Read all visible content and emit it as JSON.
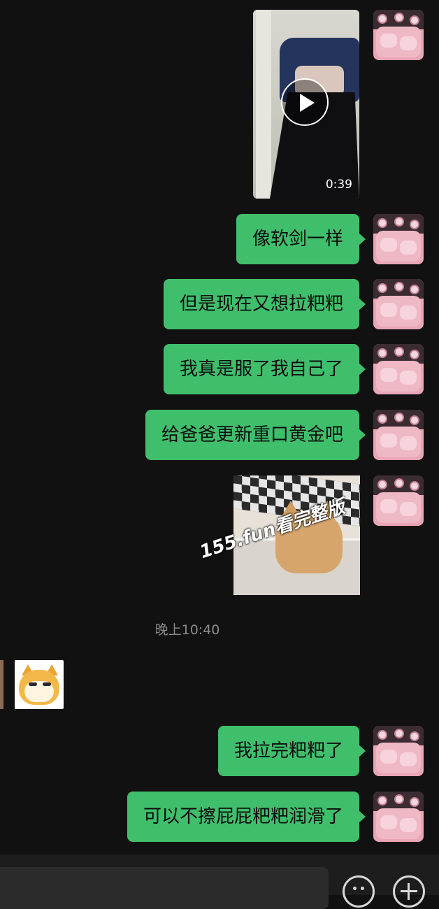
{
  "chat": {
    "video_message": {
      "duration": "0:39",
      "play_icon": "play-icon"
    },
    "messages": [
      "像软剑一样",
      "但是现在又想拉粑粑",
      "我真是服了我自己了",
      "给爸爸更新重口黄金吧"
    ],
    "sticker_message": {
      "watermark": "155.fun看完整版"
    },
    "timestamp": "晚上10:40",
    "received_sticker": "doge-sticker",
    "messages_after": [
      "我拉完粑粑了",
      "可以不擦屁屁粑粑润滑了"
    ]
  },
  "input_bar": {
    "emoji_icon": "emoji-icon",
    "add_icon": "plus-icon"
  },
  "colors": {
    "background": "#111111",
    "bubble": "#3fbf6b",
    "timestamp": "#8a8a8a"
  }
}
